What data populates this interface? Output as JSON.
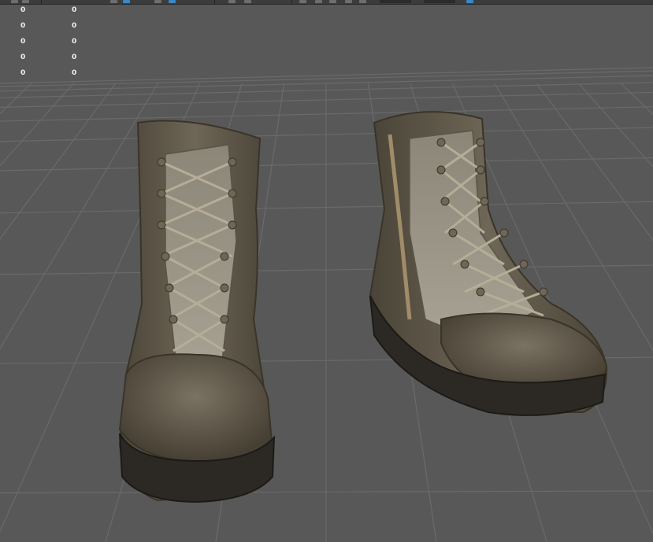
{
  "app": {
    "viewport": "perspective",
    "background_color": "#585858",
    "grid_color": "#6a6a6a",
    "accent_color": "#3a88c8"
  },
  "hud": {
    "rows": [
      {
        "col1": "0",
        "col2": "0"
      },
      {
        "col1": "0",
        "col2": "0"
      },
      {
        "col1": "0",
        "col2": "0"
      },
      {
        "col1": "0",
        "col2": "0"
      },
      {
        "col1": "0",
        "col2": "0"
      }
    ]
  },
  "toolbar": {
    "icons": [
      "select-icon",
      "move-icon",
      "rotate-icon",
      "scale-icon",
      "snap-icon",
      "camera-icon",
      "render-icon"
    ]
  },
  "model": {
    "objects": [
      "left-boot",
      "right-boot"
    ],
    "material_color": "#5d5548"
  }
}
